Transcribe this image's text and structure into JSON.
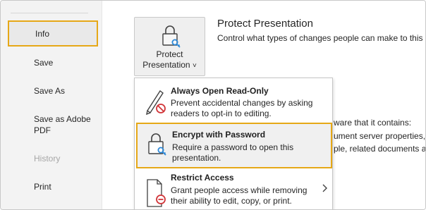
{
  "sidebar": {
    "items": [
      {
        "label": "Info",
        "state": "active"
      },
      {
        "label": "Save",
        "state": "normal"
      },
      {
        "label": "Save As",
        "state": "normal"
      },
      {
        "label": "Save as Adobe PDF",
        "line1": "Save as Adobe",
        "line2": "PDF",
        "state": "normal"
      },
      {
        "label": "History",
        "state": "disabled"
      },
      {
        "label": "Print",
        "state": "normal"
      }
    ]
  },
  "protect": {
    "button_line1": "Protect",
    "button_line2": "Presentation",
    "chevron": "˅",
    "title": "Protect Presentation",
    "description": "Control what types of changes people can make to this"
  },
  "background_text": {
    "line1": "ware that it contains:",
    "line2": "ument server properties,",
    "line3": "ple, related documents a"
  },
  "menu": {
    "items": [
      {
        "title": "Always Open Read-Only",
        "desc_line1": "Prevent accidental changes by asking",
        "desc_line2": "readers to opt-in to editing.",
        "icon": "pencil-no-icon"
      },
      {
        "title": "Encrypt with Password",
        "desc_line1": "Require a password to open this",
        "desc_line2": "presentation.",
        "icon": "lock-key-icon",
        "highlight": true
      },
      {
        "title": "Restrict Access",
        "desc_line1": "Grant people access while removing",
        "desc_line2": "their ability to edit, copy, or print.",
        "icon": "document-restrict-icon",
        "has_submenu": true
      }
    ]
  },
  "colors": {
    "highlight_border": "#e6a817",
    "sidebar_bg": "#f3f3f3",
    "restrict_red": "#d13438",
    "key_blue": "#2b88d8"
  }
}
